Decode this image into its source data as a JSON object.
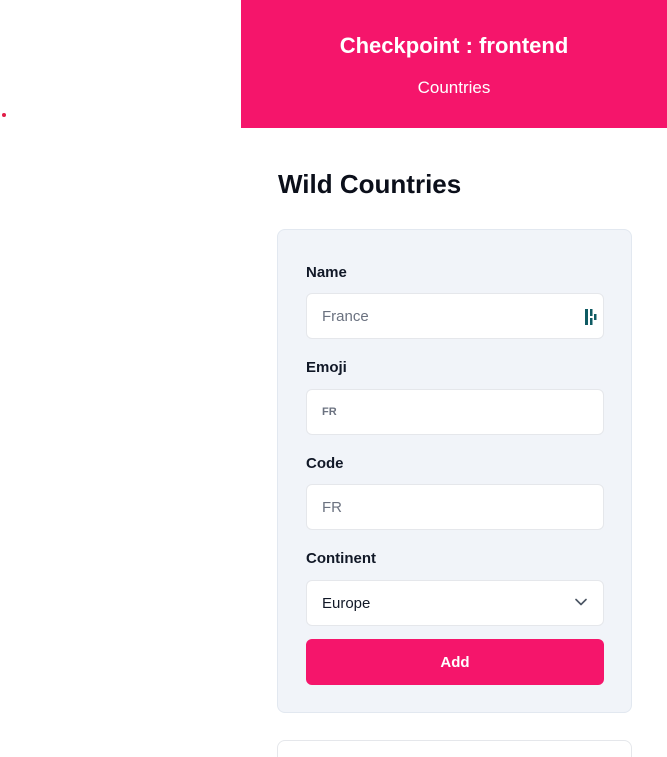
{
  "header": {
    "title": "Checkpoint : frontend",
    "subtitle": "Countries",
    "background_color": "#f5156b"
  },
  "main": {
    "title": "Wild Countries"
  },
  "form": {
    "name": {
      "label": "Name",
      "placeholder": "France",
      "icon": "password-manager-autofill-icon"
    },
    "emoji": {
      "label": "Emoji",
      "placeholder": "FR"
    },
    "code": {
      "label": "Code",
      "placeholder": "FR"
    },
    "continent": {
      "label": "Continent",
      "selected": "Europe",
      "icon": "chevron-down-icon"
    },
    "submit_label": "Add",
    "accent_color": "#f5156b",
    "card_background": "#f1f4f9"
  }
}
